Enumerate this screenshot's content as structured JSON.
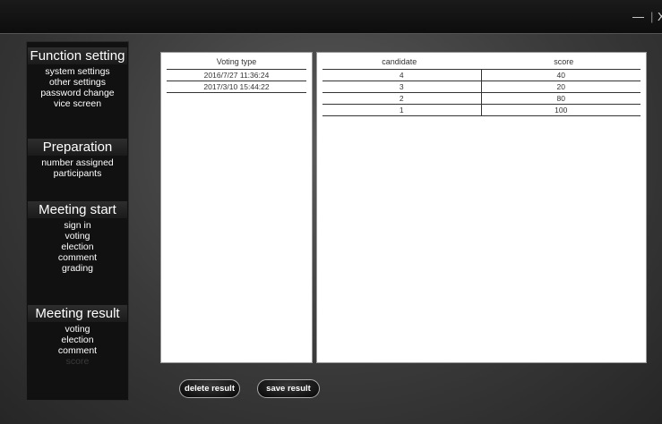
{
  "window": {
    "minimize_label": "—",
    "separator": "|",
    "close_label": "X"
  },
  "sidebar": {
    "sections": [
      {
        "title": "Function setting",
        "items": [
          "system settings",
          "other settings",
          "password change",
          "vice screen"
        ]
      },
      {
        "title": "Preparation",
        "items": [
          "number assigned",
          "participants"
        ]
      },
      {
        "title": "Meeting start",
        "items": [
          "sign in",
          "voting",
          "election",
          "comment",
          "grading"
        ]
      },
      {
        "title": "Meeting result",
        "items": [
          "voting",
          "election",
          "comment",
          "score"
        ]
      }
    ]
  },
  "voting_list": {
    "header": "Voting type",
    "rows": [
      "2016/7/27 11:36:24",
      "2017/3/10 15:44:22"
    ]
  },
  "results": {
    "headers": [
      "candidate",
      "score"
    ],
    "rows": [
      [
        "4",
        "40"
      ],
      [
        "3",
        "20"
      ],
      [
        "2",
        "80"
      ],
      [
        "1",
        "100"
      ]
    ]
  },
  "actions": {
    "delete_label": "delete result",
    "save_label": "save result"
  }
}
